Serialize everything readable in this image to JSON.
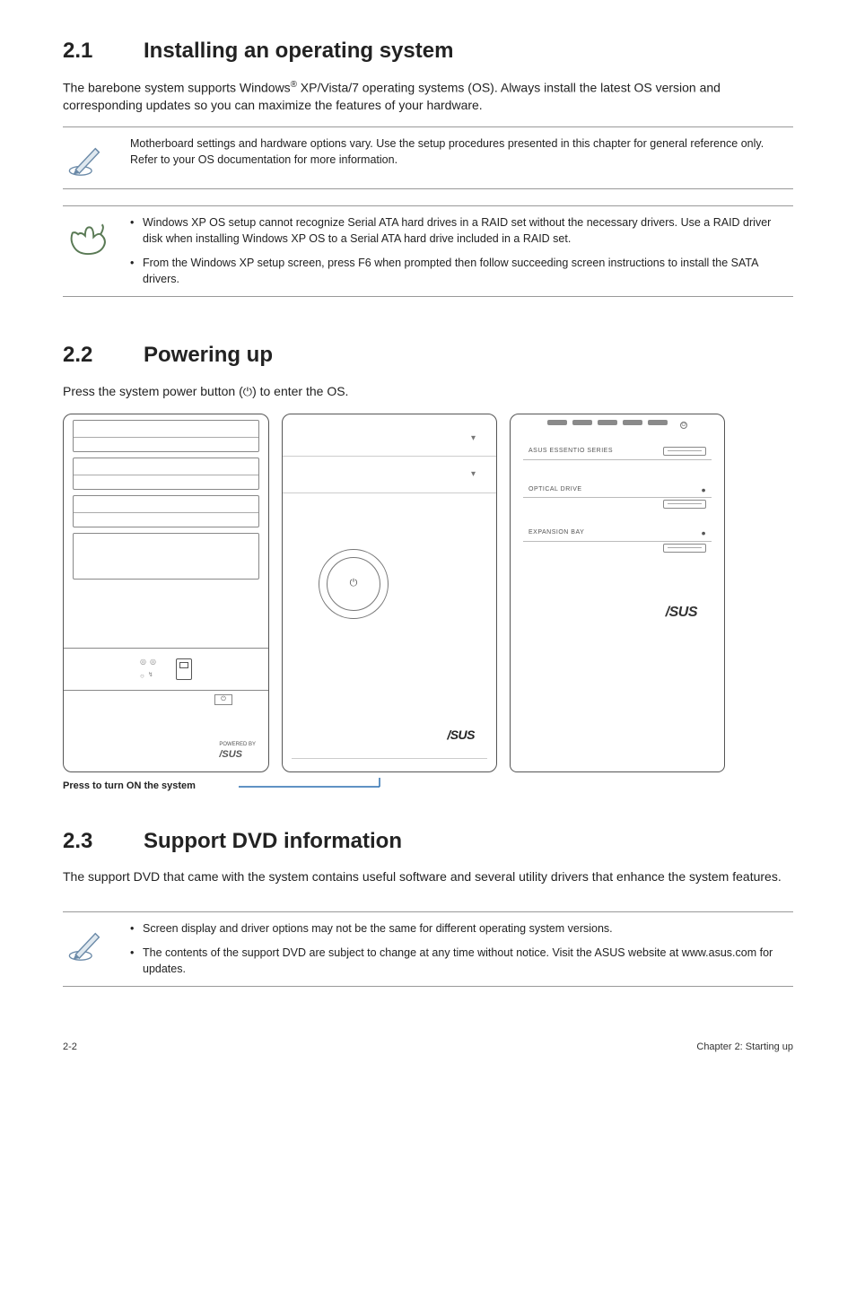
{
  "section1": {
    "number": "2.1",
    "title": "Installing an operating system",
    "intro_a": "The barebone system supports Windows",
    "intro_sup": "®",
    "intro_b": " XP/Vista/7 operating systems (OS). Always install the latest OS version and corresponding updates so you can maximize the features of your hardware.",
    "note1": "Motherboard settings and hardware options vary. Use the setup procedures presented in this chapter for general reference only. Refer to your OS documentation for more information.",
    "note2_bullets": [
      "Windows XP OS setup cannot recognize Serial ATA hard drives in a RAID set without the necessary drivers. Use a RAID driver disk when installing Windows XP OS to a Serial ATA hard drive included in a RAID set.",
      "From the Windows XP setup screen, press F6 when prompted then follow succeeding screen instructions to install the SATA drivers."
    ]
  },
  "section2": {
    "number": "2.2",
    "title": "Powering up",
    "body_a": "Press the system power button (",
    "body_b": ") to enter the OS.",
    "chassis1_poweredby": "POWERED BY",
    "chassis2_asus": "/SUS",
    "chassis3_series": "ASUS ESSENTIO SERIES",
    "chassis3_optical": "OPTICAL DRIVE",
    "chassis3_expansion": "EXPANSION BAY",
    "chassis3_asus": "/SUS",
    "callout": "Press to turn ON the system"
  },
  "section3": {
    "number": "2.3",
    "title": "Support DVD information",
    "body": "The support DVD that came with the system contains useful software and several utility drivers that enhance the system features.",
    "note_bullets": [
      "Screen display and driver options may not be the same for different operating system versions.",
      "The contents of the support DVD are subject to change at any time without notice. Visit the ASUS website at www.asus.com for updates."
    ]
  },
  "footer": {
    "left": "2-2",
    "right": "Chapter 2: Starting up"
  },
  "icons": {
    "pencil": "pencil-note-icon",
    "hand": "hand-point-icon",
    "power": "⏻"
  }
}
